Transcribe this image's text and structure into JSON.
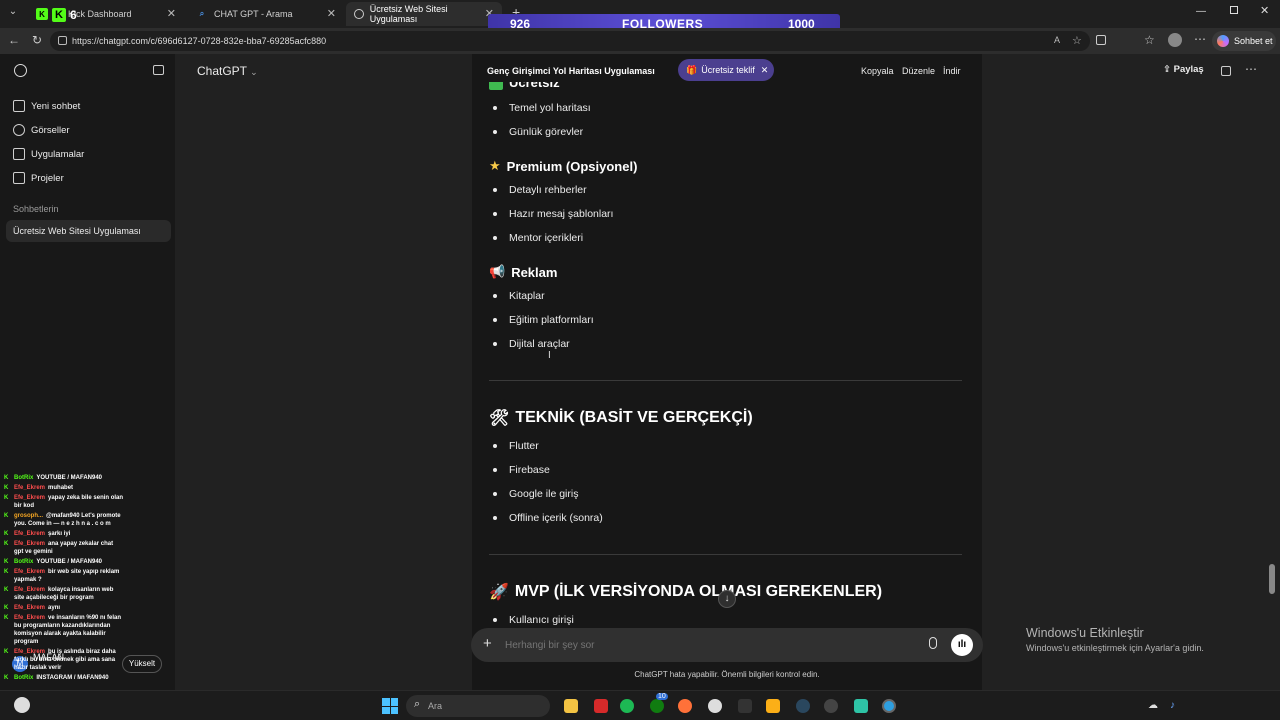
{
  "browser": {
    "tabs": [
      {
        "label": "Kick Dashboard",
        "favicon_color": "#53fc18"
      },
      {
        "label": "CHAT GPT - Arama",
        "favicon_color": "#4a90e2"
      },
      {
        "label": "Ücretsiz Web Sitesi Uygulaması",
        "favicon_color": "#cccccc"
      }
    ],
    "url": "https://chatgpt.com/c/696d6127-0728-832e-bba7-69285acfc880",
    "copilot_label": "Sohbet et",
    "kick_badge": "6"
  },
  "stream_overlay": {
    "current": "926",
    "label": "FOLLOWERS",
    "goal": "1000",
    "progress": 0.926
  },
  "sidebar": {
    "items": [
      {
        "label": "Yeni sohbet",
        "icon": "edit-icon"
      },
      {
        "label": "Görseller",
        "icon": "image-icon"
      },
      {
        "label": "Uygulamalar",
        "icon": "apps-icon"
      },
      {
        "label": "Projeler",
        "icon": "folder-icon"
      }
    ],
    "section_title": "Sohbetlerin",
    "chats": [
      "Ücretsiz Web Sitesi Uygulaması"
    ],
    "user_initial": "M",
    "user_name": "MAFAN",
    "upgrade_label": "Yükselt"
  },
  "header": {
    "model": "ChatGPT",
    "doc_title": "Genç Girişimci Yol Haritası Uygulaması",
    "badge": "Ücretsiz teklif",
    "actions": [
      "Kopyala",
      "Düzenle",
      "İndir"
    ],
    "share": "Paylaş"
  },
  "content": {
    "partial_heading": "Ücretsiz",
    "free_items": [
      "Temel yol haritası",
      "Günlük görevler"
    ],
    "premium": {
      "title": "Premium (Opsiyonel)",
      "items": [
        "Detaylı rehberler",
        "Hazır mesaj şablonları",
        "Mentor içerikleri"
      ]
    },
    "ads": {
      "title": "Reklam",
      "items": [
        "Kitaplar",
        "Eğitim platformları",
        "Dijital araçlar"
      ]
    },
    "tech": {
      "title": "TEKNİK (BASİT VE GERÇEKÇİ)",
      "items": [
        "Flutter",
        "Firebase",
        "Google ile giriş",
        "Offline içerik (sonra)"
      ]
    },
    "mvp": {
      "title": "MVP (İLK VERSİYONDA OLMASI GEREKENLER)",
      "items": [
        "Kullanıcı girişi"
      ]
    }
  },
  "composer": {
    "placeholder": "Herhangi bir şey sor",
    "disclaimer": "ChatGPT hata yapabilir. Önemli bilgileri kontrol edin."
  },
  "activation": {
    "title": "Windows'u Etkinleştir",
    "subtitle": "Windows'u etkinleştirmek için Ayarlar'a gidin."
  },
  "chat_overlay": [
    {
      "user": "BotRix",
      "msg": "YOUTUBE / MAFAN940",
      "color": "#53fc18"
    },
    {
      "user": "Efe_Ekrem",
      "msg": "muhabet",
      "color": "#ff4d4d"
    },
    {
      "user": "Efe_Ekrem",
      "msg": "yapay zeka bile senin olan bir kod",
      "color": "#ff4d4d"
    },
    {
      "user": "grosoph...",
      "msg": "@mafan940 Let's promote you. Come in — n e z h n a . c o m",
      "color": "#f5a623"
    },
    {
      "user": "Efe_Ekrem",
      "msg": "şarkı iyi",
      "color": "#ff4d4d"
    },
    {
      "user": "Efe_Ekrem",
      "msg": "ana yapay zekalar chat gpt ve gemini",
      "color": "#ff4d4d"
    },
    {
      "user": "BotRix",
      "msg": "YOUTUBE / MAFAN940",
      "color": "#53fc18"
    },
    {
      "user": "Efe_Ekrem",
      "msg": "bir web site yapıp reklam yapmak ?",
      "color": "#ff4d4d"
    },
    {
      "user": "Efe_Ekrem",
      "msg": "kolayca insanların web site açabileceği bir program",
      "color": "#ff4d4d"
    },
    {
      "user": "Efe_Ekrem",
      "msg": "aynı",
      "color": "#ff4d4d"
    },
    {
      "user": "Efe_Ekrem",
      "msg": "ve insanların %90 nı felan bu programların kazandıklarından komisyon alarak ayakta kalabilir program",
      "color": "#ff4d4d"
    },
    {
      "user": "Efe_Ekrem",
      "msg": "bu iş aslında biraz daha farklı bu bina dikmek gibi ama sana hazır taslak verir",
      "color": "#ff4d4d"
    },
    {
      "user": "BotRix",
      "msg": "INSTAGRAM / MAFAN940",
      "color": "#53fc18"
    }
  ],
  "taskbar": {
    "search_placeholder": "Ara",
    "badge": "10"
  }
}
